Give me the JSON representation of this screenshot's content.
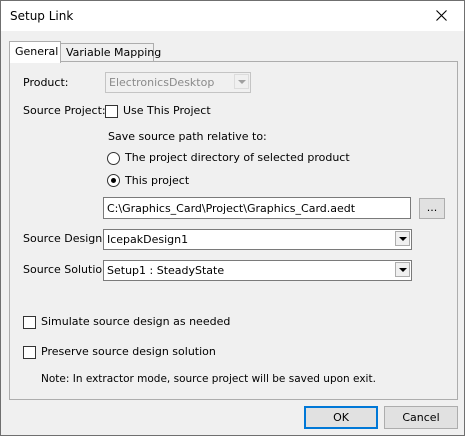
{
  "window": {
    "title": "Setup Link"
  },
  "tabs": [
    {
      "label": "General"
    },
    {
      "label": "Variable Mapping"
    }
  ],
  "general": {
    "product": {
      "label": "Product:",
      "value": "ElectronicsDesktop"
    },
    "source_project": {
      "label": "Source Project:",
      "use_this_project_label": "Use This Project",
      "use_this_project_checked": false,
      "relative_to_label": "Save source path relative to:",
      "radio_options": [
        {
          "label": "The project directory of selected product",
          "selected": false
        },
        {
          "label": "This project",
          "selected": true
        }
      ],
      "path": "C:\\Graphics_Card\\Project\\Graphics_Card.aedt",
      "browse_label": "..."
    },
    "source_design": {
      "label": "Source Design:",
      "value": "IcepakDesign1"
    },
    "source_solution": {
      "label": "Source Solution:",
      "value": "Setup1 : SteadyState"
    },
    "simulate_label": "Simulate source design as needed",
    "simulate_checked": false,
    "preserve_label": "Preserve source design solution",
    "preserve_checked": false,
    "note": "Note: In extractor mode, source project will be saved upon exit."
  },
  "buttons": {
    "ok": "OK",
    "cancel": "Cancel"
  },
  "icons": {
    "close": "close-icon",
    "dropdown": "chevron-down-icon"
  },
  "colors": {
    "accent": "#0078d7",
    "background": "#f0f0f0"
  }
}
